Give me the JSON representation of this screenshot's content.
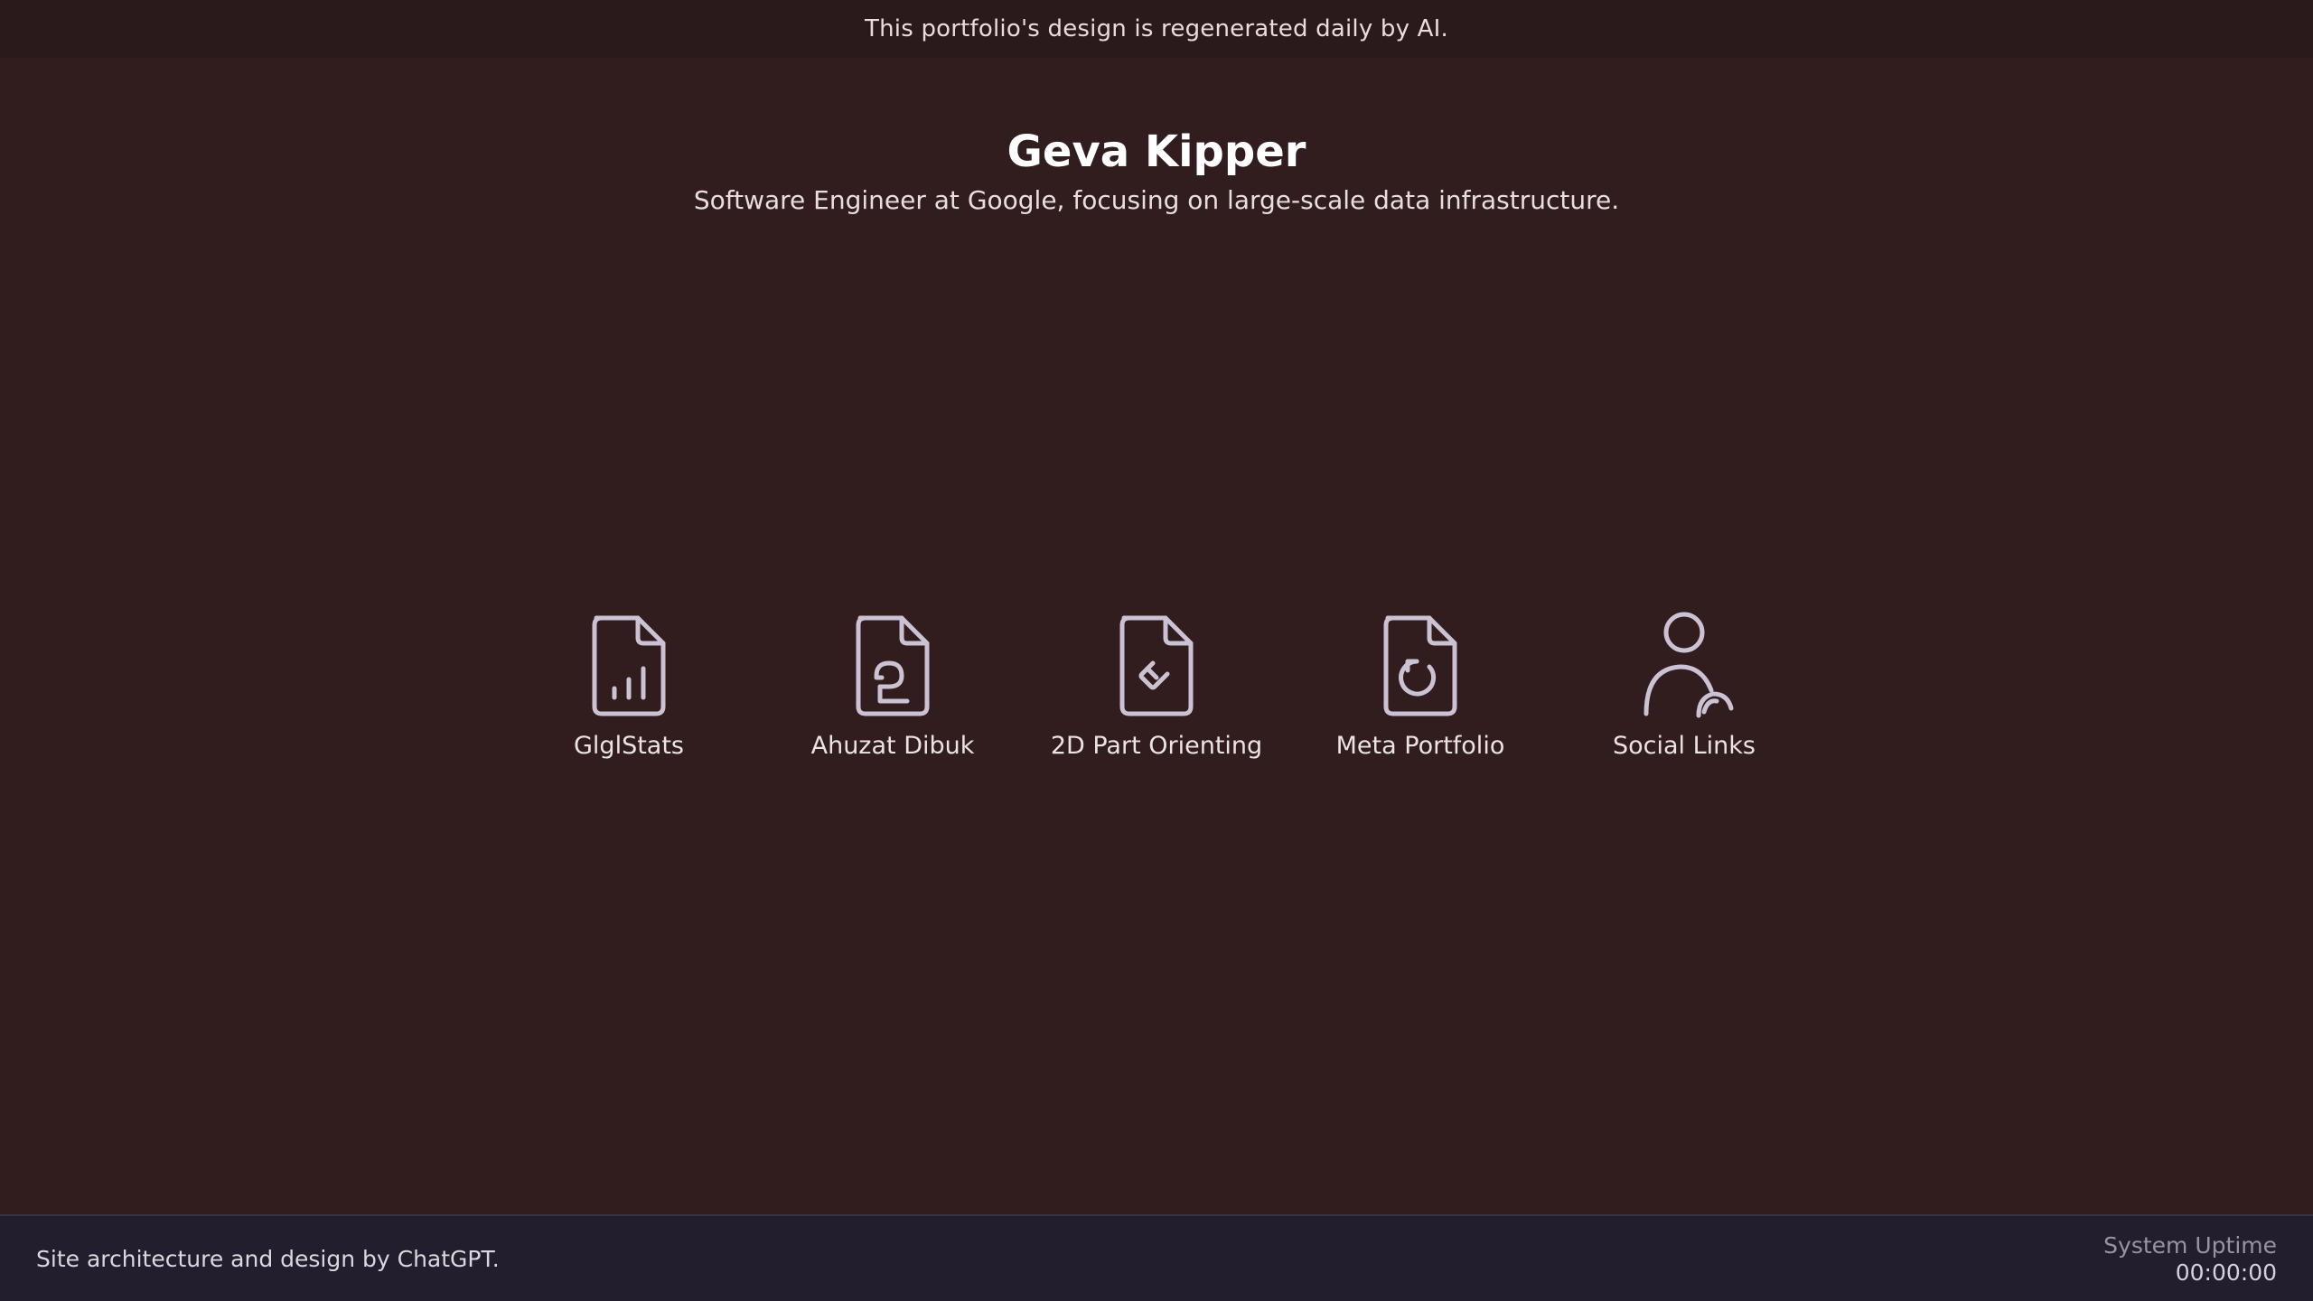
{
  "banner": {
    "text": "This portfolio's design is regenerated daily by AI."
  },
  "header": {
    "title": "Geva Kipper",
    "subtitle": "Software Engineer at Google, focusing on large-scale data infrastructure."
  },
  "projects": [
    {
      "label": "GlglStats",
      "icon": "file-chart-icon"
    },
    {
      "label": "Ahuzat Dibuk",
      "icon": "file-parking-icon"
    },
    {
      "label": "2D Part Orienting",
      "icon": "file-rotate-icon"
    },
    {
      "label": "Meta Portfolio",
      "icon": "file-cycle-icon"
    },
    {
      "label": "Social Links",
      "icon": "people-icon"
    }
  ],
  "footer": {
    "credit": "Site architecture and design by ChatGPT.",
    "uptime_label": "System Uptime",
    "uptime_value": "00:00:00"
  },
  "colors": {
    "background": "#311d1e",
    "banner": "#2a1a1c",
    "footer": "#231e2e",
    "icon_stroke": "#cbc3d3"
  }
}
